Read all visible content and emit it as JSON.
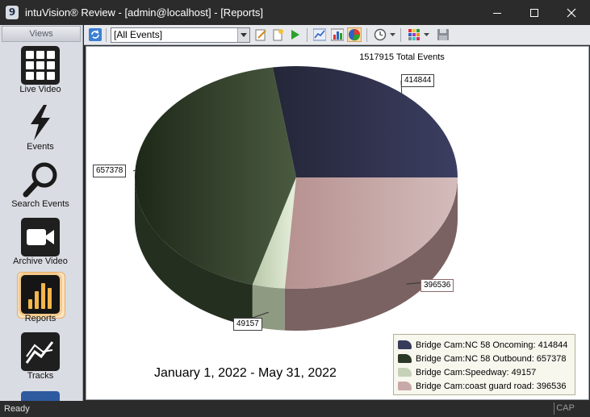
{
  "window": {
    "title": "intuVision® Review - [admin@localhost] - [Reports]",
    "app_icon": "app-logo-icon"
  },
  "views": {
    "header": "Views",
    "items": [
      {
        "label": "Live Video",
        "icon": "grid-icon",
        "active": false
      },
      {
        "label": "Events",
        "icon": "lightning-icon",
        "active": false
      },
      {
        "label": "Search Events",
        "icon": "magnifier-icon",
        "active": false
      },
      {
        "label": "Archive Video",
        "icon": "video-camera-icon",
        "active": false
      },
      {
        "label": "Reports",
        "icon": "bar-chart-icon",
        "active": true
      },
      {
        "label": "Tracks",
        "icon": "line-chart-icon",
        "active": false
      }
    ]
  },
  "toolbar": {
    "event_filter": "[All Events]",
    "buttons": [
      "refresh-icon",
      "edit-icon",
      "new-report-icon",
      "run-icon",
      "line-chart-icon",
      "bar-chart-icon",
      "pie-chart-icon",
      "clock-icon",
      "palette-icon",
      "save-icon"
    ]
  },
  "chart_data": {
    "type": "pie",
    "title": "1517915 Total Events",
    "subtitle": "January  1, 2022 - May 31, 2022",
    "series": [
      {
        "name": "Bridge Cam:NC 58 Oncoming",
        "value": 414844,
        "color": "#383a5c"
      },
      {
        "name": "Bridge Cam:NC 58 Outbound",
        "value": 657378,
        "color": "#3c4a34"
      },
      {
        "name": "Bridge Cam:Speedway",
        "value": 49157,
        "color": "#c6d2b8"
      },
      {
        "name": "Bridge Cam:coast guard road",
        "value": 396536,
        "color": "#c8a9a8"
      }
    ],
    "legend": [
      "Bridge Cam:NC 58 Oncoming: 414844",
      "Bridge Cam:NC 58 Outbound: 657378",
      "Bridge Cam:Speedway: 49157",
      "Bridge Cam:coast guard road: 396536"
    ],
    "legend_position": "bottom-right"
  },
  "status": {
    "text": "Ready",
    "cap": "CAP"
  }
}
